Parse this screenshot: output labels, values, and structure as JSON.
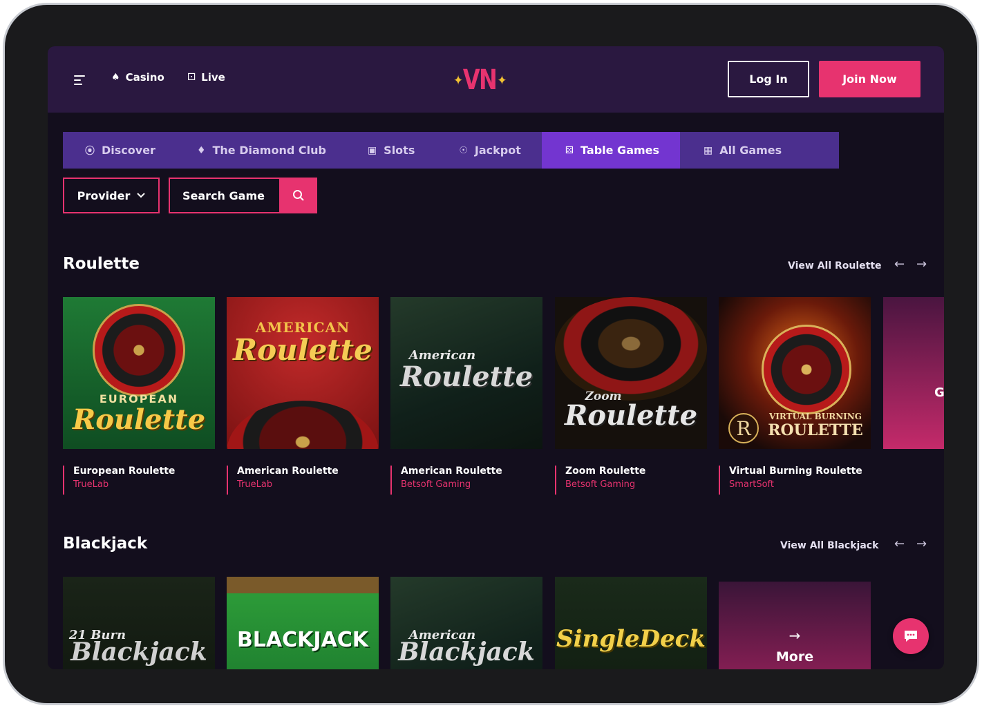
{
  "header": {
    "nav": [
      {
        "label": "Casino",
        "icon": "cherries-icon"
      },
      {
        "label": "Live",
        "icon": "dice-icon"
      }
    ],
    "logo_text": "VN",
    "login_label": "Log In",
    "join_label": "Join Now"
  },
  "tabs": [
    {
      "label": "Discover",
      "icon": "compass-icon",
      "active": false
    },
    {
      "label": "The Diamond Club",
      "icon": "diamond-card-icon",
      "active": false
    },
    {
      "label": "Slots",
      "icon": "slot-machine-icon",
      "active": false
    },
    {
      "label": "Jackpot",
      "icon": "coins-icon",
      "active": false
    },
    {
      "label": "Table Games",
      "icon": "dice-icon",
      "active": true
    },
    {
      "label": "All Games",
      "icon": "grid-icon",
      "active": false
    }
  ],
  "filters": {
    "provider_label": "Provider",
    "search_placeholder": "Search Game"
  },
  "roulette": {
    "title": "Roulette",
    "view_all": "View All Roulette",
    "games": [
      {
        "name": "European Roulette",
        "provider": "TrueLab",
        "art_top": "EUROPEAN",
        "art_main": "Roulette"
      },
      {
        "name": "American Roulette",
        "provider": "TrueLab",
        "art_top": "AMERICAN",
        "art_main": "Roulette"
      },
      {
        "name": "American Roulette",
        "provider": "Betsoft Gaming",
        "art_top": "American",
        "art_main": "Roulette"
      },
      {
        "name": "Zoom Roulette",
        "provider": "Betsoft Gaming",
        "art_top": "Zoom",
        "art_main": "Roulette"
      },
      {
        "name": "Virtual Burning Roulette",
        "provider": "SmartSoft",
        "art_top": "VIRTUAL BURNING",
        "art_main": "ROULETTE"
      }
    ],
    "partial_card_text": "G"
  },
  "blackjack": {
    "title": "Blackjack",
    "view_all": "View All Blackjack",
    "games": [
      {
        "art_top": "21 Burn",
        "art_main": "Blackjack"
      },
      {
        "art_top": "",
        "art_main": "BLACKJACK"
      },
      {
        "art_top": "American",
        "art_main": "Blackjack"
      },
      {
        "art_top": "",
        "art_main": "SingleDeck"
      }
    ],
    "more_label": "More"
  },
  "colors": {
    "accent": "#e7336f",
    "topbar": "#2a1840",
    "tabbar": "#4b2f8e",
    "tab_active": "#7335d0",
    "background": "#130e1d"
  }
}
